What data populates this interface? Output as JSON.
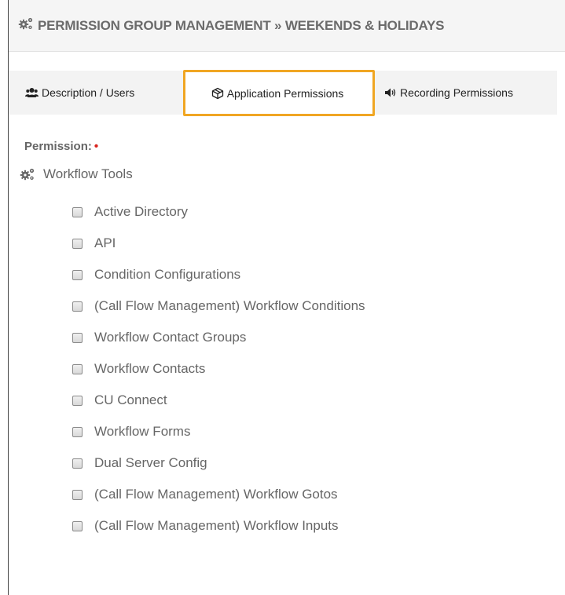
{
  "header": {
    "title": "PERMISSION GROUP MANAGEMENT » WEEKENDS & HOLIDAYS",
    "icon": "gears-icon"
  },
  "tabs": [
    {
      "label": "Description / Users",
      "icon": "users-icon",
      "active": false
    },
    {
      "label": "Application Permissions",
      "icon": "cube-icon",
      "active": true
    },
    {
      "label": "Recording Permissions",
      "icon": "volume-icon",
      "active": false
    }
  ],
  "form": {
    "permission_label": "Permission:",
    "required_mark": "•"
  },
  "group": {
    "label": "Workflow Tools",
    "icon": "gears-icon"
  },
  "permissions": [
    {
      "label": "Active Directory",
      "checked": false
    },
    {
      "label": "API",
      "checked": false
    },
    {
      "label": "Condition Configurations",
      "checked": false
    },
    {
      "label": "(Call Flow Management) Workflow Conditions",
      "checked": false
    },
    {
      "label": "Workflow Contact Groups",
      "checked": false
    },
    {
      "label": "Workflow Contacts",
      "checked": false
    },
    {
      "label": "CU Connect",
      "checked": false
    },
    {
      "label": "Workflow Forms",
      "checked": false
    },
    {
      "label": "Dual Server Config",
      "checked": false
    },
    {
      "label": "(Call Flow Management) Workflow Gotos",
      "checked": false
    },
    {
      "label": "(Call Flow Management) Workflow Inputs",
      "checked": false
    }
  ],
  "colors": {
    "highlight": "#f0a623",
    "required": "#d9241e"
  }
}
